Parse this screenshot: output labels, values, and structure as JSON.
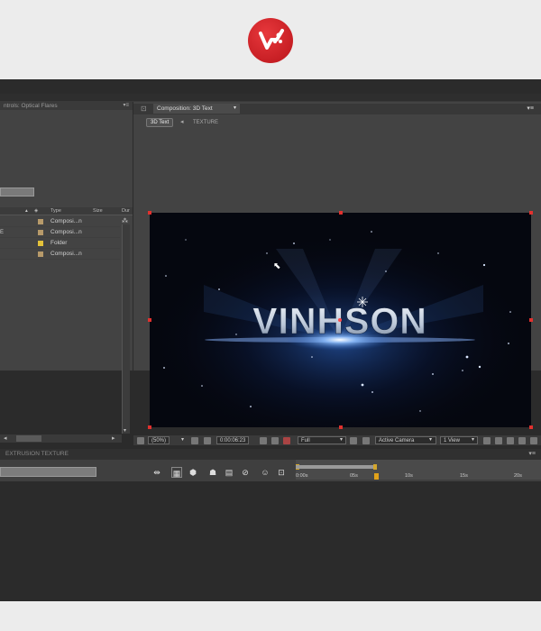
{
  "brand": {
    "logo_icon": "vm-logo-icon",
    "color": "#d61f26"
  },
  "project_panel": {
    "tab_label": "ntrols: Optical Flares",
    "menu_icon": "▾≡",
    "columns": {
      "type": "Type",
      "size": "Size",
      "duration": "Dur"
    },
    "rows": [
      {
        "edge": "",
        "type": "Composi...n",
        "color": "#b79a6a"
      },
      {
        "edge": "E",
        "type": "Composi...n",
        "color": "#b79a6a"
      },
      {
        "edge": "",
        "type": "Folder",
        "color": "#e4c23a"
      },
      {
        "edge": "",
        "type": "Composi...n",
        "color": "#b79a6a"
      }
    ]
  },
  "composition_panel": {
    "tab_title": "Composition: 3D Text",
    "tab_menu": "▾≡",
    "breadcrumbs": [
      "3D Text",
      "TEXTURE"
    ],
    "viewer_text": "VINHSON",
    "toolbar": {
      "zoom": "(50%)",
      "timecode": "0:00:06:23",
      "resolution": "Full",
      "camera": "Active Camera",
      "views": "1 View"
    }
  },
  "timeline": {
    "tab_label": "EXTRUSION TEXTURE",
    "ticks": [
      "0:00s",
      "05s",
      "10s",
      "15s",
      "20s"
    ],
    "current_time_fraction": 0.32
  }
}
